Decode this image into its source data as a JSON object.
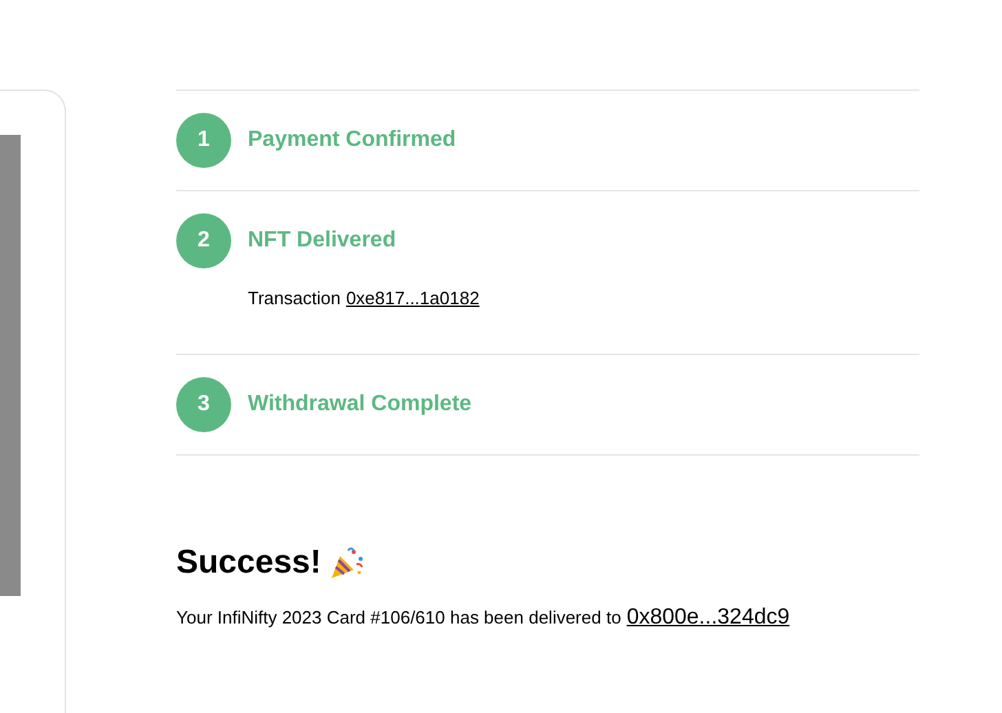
{
  "steps": [
    {
      "number": "1",
      "title": "Payment Confirmed",
      "completed": true
    },
    {
      "number": "2",
      "title": "NFT Delivered",
      "completed": true,
      "detail_label": "Transaction",
      "detail_link": "0xe817...1a0182"
    },
    {
      "number": "3",
      "title": "Withdrawal Complete",
      "completed": true
    }
  ],
  "success": {
    "title": "Success!",
    "message": "Your InfiNifty 2023 Card #106/610 has been delivered to",
    "address": "0x800e...324dc9"
  }
}
